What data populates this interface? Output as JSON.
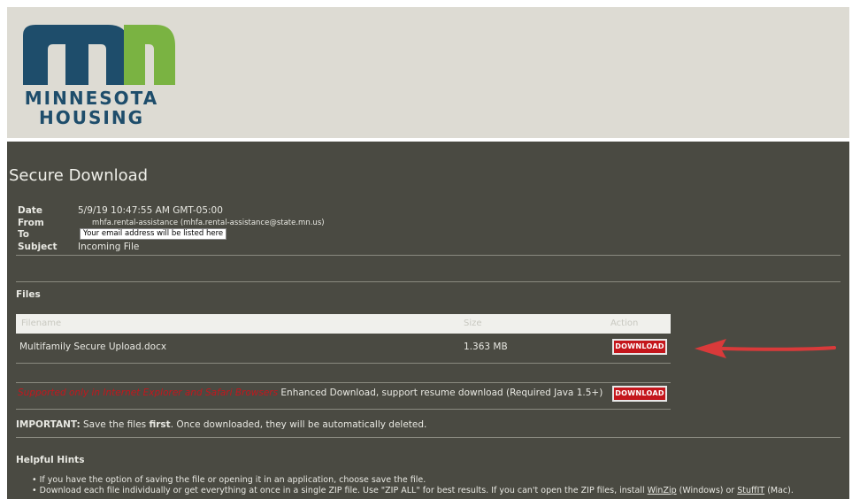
{
  "logo": {
    "line1": "MINNESOTA",
    "line2": "HOUSING",
    "m_color": "#1e4d6b",
    "n_color": "#7ab342"
  },
  "page": {
    "title": "Secure Download"
  },
  "meta": {
    "date_label": "Date",
    "date_value": "5/9/19 10:47:55 AM GMT-05:00",
    "from_label": "From",
    "from_value": "mhfa.rental-assistance (mhfa.rental-assistance@state.mn.us)",
    "to_label": "To",
    "to_value": "Your email address will be listed here",
    "subject_label": "Subject",
    "subject_value": "Incoming File"
  },
  "files": {
    "section_label": "Files",
    "headers": {
      "filename": "Filename",
      "size": "Size",
      "action": "Action"
    },
    "rows": [
      {
        "filename": "Multifamily Secure Upload.docx",
        "size": "1.363 MB",
        "action": "DOWNLOAD"
      }
    ]
  },
  "enhanced": {
    "warning": "Supported only in Internet Explorer and Safari Browsers",
    "text": " Enhanced Download, support resume download (Required Java 1.5+)",
    "button": "DOWNLOAD"
  },
  "important": {
    "label": "IMPORTANT:",
    "text1": " Save the files ",
    "bold": "first",
    "text2": ". Once downloaded, they will be automatically deleted."
  },
  "hints": {
    "title": "Helpful Hints",
    "item1": "If you have the option of saving the file or opening it in an application, choose save the file.",
    "item2_pre": "Download each file individually or get everything at once in a single ZIP file. Use \"ZIP ALL\" for best results. If you can't open the ZIP files, install ",
    "winzip": "WinZip",
    "item2_mid": " (Windows) or ",
    "stuffit": "StuffIT",
    "item2_post": " (Mac)."
  },
  "colors": {
    "accent_red": "#c4161c",
    "panel": "#4a4a42",
    "header_bg": "#dddbd3"
  }
}
